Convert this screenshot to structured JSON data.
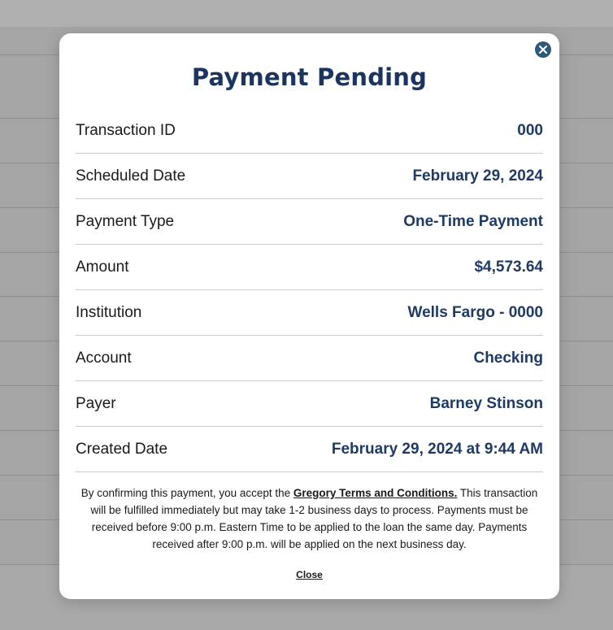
{
  "modal": {
    "title": "Payment Pending",
    "close_icon": "close-icon",
    "rows": [
      {
        "label": "Transaction ID",
        "value": "000"
      },
      {
        "label": "Scheduled Date",
        "value": "February 29, 2024"
      },
      {
        "label": "Payment Type",
        "value": "One-Time Payment"
      },
      {
        "label": "Amount",
        "value": "$4,573.64"
      },
      {
        "label": "Institution",
        "value": "Wells Fargo - 0000"
      },
      {
        "label": "Account",
        "value": "Checking"
      },
      {
        "label": "Payer",
        "value": "Barney Stinson"
      },
      {
        "label": "Created Date",
        "value": "February 29, 2024 at 9:44 AM"
      }
    ],
    "disclaimer": {
      "before": "By confirming this payment, you accept the ",
      "link": "Gregory Terms and Conditions.",
      "after": " This transaction will be fulfilled immediately but may take 1-2 business days to process. Payments must be received before 9:00 p.m. Eastern Time to be applied to the loan the same day. Payments received after 9:00 p.m. will be applied on the next business day."
    },
    "close_label": "Close"
  },
  "colors": {
    "title": "#1c3560",
    "value": "#1f3a63",
    "close_button": "#2e5a78",
    "overlay": "#a9a9a9"
  }
}
